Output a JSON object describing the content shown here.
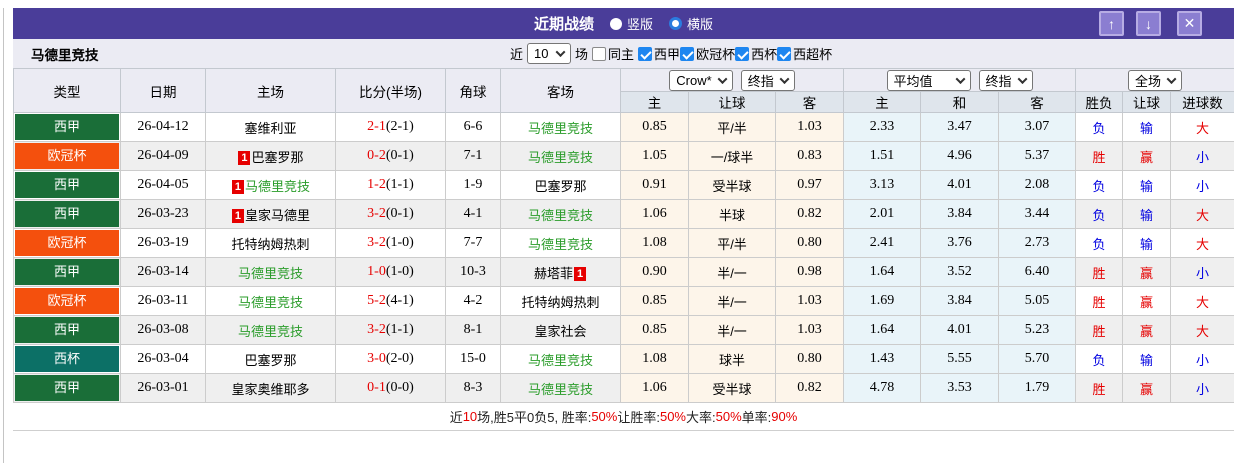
{
  "colors": {
    "titlebar_bg": "#4a3d99",
    "button_bg": "#8b7ed1",
    "filter_bg": "#ebebf3",
    "header_bg": "#dfe5ec",
    "stripe_bg": "#efefef",
    "crow_cell_bg": "#fdf5ea",
    "avg_cell_bg": "#e9f4f9",
    "self_team": "#2a9c2a",
    "score_red": "#e60000",
    "checkbox_blue": "#1e86f0",
    "types": {
      "西甲": "#1a6e38",
      "欧冠杯": "#f4500d",
      "西杯": "#0c7066"
    },
    "result": {
      "胜": "#e60000",
      "赢": "#e60000",
      "大": "#e60000",
      "负": "#0000e1",
      "输": "#0000e1",
      "小": "#0000e1"
    }
  },
  "titlebar": {
    "title": "近期战绩",
    "radio_vertical": "竖版",
    "radio_horizontal": "横版",
    "selected": "横版"
  },
  "filter": {
    "team": "马德里竞技",
    "near_label": "近",
    "count": "10",
    "games_label": "场",
    "same_host_label": "同主",
    "same_host_checked": false,
    "leagues": [
      {
        "label": "西甲",
        "checked": true
      },
      {
        "label": "欧冠杯",
        "checked": true
      },
      {
        "label": "西杯",
        "checked": true
      },
      {
        "label": "西超杯",
        "checked": true
      }
    ]
  },
  "controls": {
    "crow_company": "Crow*",
    "crow_index": "终指",
    "avg_company": "平均值",
    "avg_index": "终指",
    "scope": "全场"
  },
  "table": {
    "headers_left": [
      "类型",
      "日期",
      "主场",
      "比分(半场)",
      "角球",
      "客场"
    ],
    "headers_right": [
      "主",
      "让球",
      "客",
      "主",
      "和",
      "客",
      "胜负",
      "让球",
      "进球数"
    ],
    "rows": [
      {
        "type": "西甲",
        "date": "26-04-12",
        "home": "塞维利亚",
        "home_self": false,
        "home_badge": "",
        "score_ft": "2-1",
        "score_ht": "(2-1)",
        "corner": "6-6",
        "away": "马德里竞技",
        "away_self": true,
        "away_badge": "",
        "crow": [
          "0.85",
          "平/半",
          "1.03"
        ],
        "avg": [
          "2.33",
          "3.47",
          "3.07"
        ],
        "results": [
          "负",
          "输",
          "大"
        ]
      },
      {
        "type": "欧冠杯",
        "date": "26-04-09",
        "home": "巴塞罗那",
        "home_self": false,
        "home_badge": "1",
        "score_ft": "0-2",
        "score_ht": "(0-1)",
        "corner": "7-1",
        "away": "马德里竞技",
        "away_self": true,
        "away_badge": "",
        "crow": [
          "1.05",
          "一/球半",
          "0.83"
        ],
        "avg": [
          "1.51",
          "4.96",
          "5.37"
        ],
        "results": [
          "胜",
          "赢",
          "小"
        ]
      },
      {
        "type": "西甲",
        "date": "26-04-05",
        "home": "马德里竞技",
        "home_self": true,
        "home_badge": "1",
        "score_ft": "1-2",
        "score_ht": "(1-1)",
        "corner": "1-9",
        "away": "巴塞罗那",
        "away_self": false,
        "away_badge": "",
        "crow": [
          "0.91",
          "受半球",
          "0.97"
        ],
        "avg": [
          "3.13",
          "4.01",
          "2.08"
        ],
        "results": [
          "负",
          "输",
          "小"
        ]
      },
      {
        "type": "西甲",
        "date": "26-03-23",
        "home": "皇家马德里",
        "home_self": false,
        "home_badge": "1",
        "score_ft": "3-2",
        "score_ht": "(0-1)",
        "corner": "4-1",
        "away": "马德里竞技",
        "away_self": true,
        "away_badge": "",
        "crow": [
          "1.06",
          "半球",
          "0.82"
        ],
        "avg": [
          "2.01",
          "3.84",
          "3.44"
        ],
        "results": [
          "负",
          "输",
          "大"
        ]
      },
      {
        "type": "欧冠杯",
        "date": "26-03-19",
        "home": "托特纳姆热刺",
        "home_self": false,
        "home_badge": "",
        "score_ft": "3-2",
        "score_ht": "(1-0)",
        "corner": "7-7",
        "away": "马德里竞技",
        "away_self": true,
        "away_badge": "",
        "crow": [
          "1.08",
          "平/半",
          "0.80"
        ],
        "avg": [
          "2.41",
          "3.76",
          "2.73"
        ],
        "results": [
          "负",
          "输",
          "大"
        ]
      },
      {
        "type": "西甲",
        "date": "26-03-14",
        "home": "马德里竞技",
        "home_self": true,
        "home_badge": "",
        "score_ft": "1-0",
        "score_ht": "(1-0)",
        "corner": "10-3",
        "away": "赫塔菲",
        "away_self": false,
        "away_badge": "1",
        "crow": [
          "0.90",
          "半/一",
          "0.98"
        ],
        "avg": [
          "1.64",
          "3.52",
          "6.40"
        ],
        "results": [
          "胜",
          "赢",
          "小"
        ]
      },
      {
        "type": "欧冠杯",
        "date": "26-03-11",
        "home": "马德里竞技",
        "home_self": true,
        "home_badge": "",
        "score_ft": "5-2",
        "score_ht": "(4-1)",
        "corner": "4-2",
        "away": "托特纳姆热刺",
        "away_self": false,
        "away_badge": "",
        "crow": [
          "0.85",
          "半/一",
          "1.03"
        ],
        "avg": [
          "1.69",
          "3.84",
          "5.05"
        ],
        "results": [
          "胜",
          "赢",
          "大"
        ]
      },
      {
        "type": "西甲",
        "date": "26-03-08",
        "home": "马德里竞技",
        "home_self": true,
        "home_badge": "",
        "score_ft": "3-2",
        "score_ht": "(1-1)",
        "corner": "8-1",
        "away": "皇家社会",
        "away_self": false,
        "away_badge": "",
        "crow": [
          "0.85",
          "半/一",
          "1.03"
        ],
        "avg": [
          "1.64",
          "4.01",
          "5.23"
        ],
        "results": [
          "胜",
          "赢",
          "大"
        ]
      },
      {
        "type": "西杯",
        "date": "26-03-04",
        "home": "巴塞罗那",
        "home_self": false,
        "home_badge": "",
        "score_ft": "3-0",
        "score_ht": "(2-0)",
        "corner": "15-0",
        "away": "马德里竞技",
        "away_self": true,
        "away_badge": "",
        "crow": [
          "1.08",
          "球半",
          "0.80"
        ],
        "avg": [
          "1.43",
          "5.55",
          "5.70"
        ],
        "results": [
          "负",
          "输",
          "小"
        ]
      },
      {
        "type": "西甲",
        "date": "26-03-01",
        "home": "皇家奥维耶多",
        "home_self": false,
        "home_badge": "",
        "score_ft": "0-1",
        "score_ht": "(0-0)",
        "corner": "8-3",
        "away": "马德里竞技",
        "away_self": true,
        "away_badge": "",
        "crow": [
          "1.06",
          "受半球",
          "0.82"
        ],
        "avg": [
          "4.78",
          "3.53",
          "1.79"
        ],
        "results": [
          "胜",
          "赢",
          "小"
        ]
      }
    ]
  },
  "footer": {
    "segments": [
      {
        "text": "近",
        "red": false
      },
      {
        "text": "10",
        "red": true
      },
      {
        "text": "场,胜5平0负5, 胜率:",
        "red": false
      },
      {
        "text": "50%",
        "red": true
      },
      {
        "text": " 让胜率:",
        "red": false
      },
      {
        "text": "50%",
        "red": true
      },
      {
        "text": " 大率:",
        "red": false
      },
      {
        "text": "50%",
        "red": true
      },
      {
        "text": " 单率:",
        "red": false
      },
      {
        "text": "90%",
        "red": true
      }
    ]
  }
}
